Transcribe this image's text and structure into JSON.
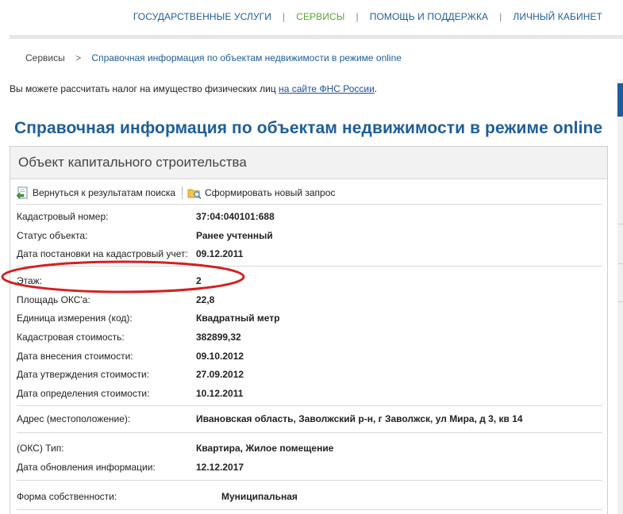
{
  "topnav": {
    "items": [
      {
        "label": "ГОСУДАРСТВЕННЫЕ УСЛУГИ",
        "active": false
      },
      {
        "label": "СЕРВИСЫ",
        "active": true
      },
      {
        "label": "ПОМОЩЬ И ПОДДЕРЖКА",
        "active": false
      },
      {
        "label": "ЛИЧНЫЙ КАБИНЕТ",
        "active": false
      }
    ],
    "separator": "|"
  },
  "breadcrumb": {
    "root": "Сервисы",
    "separator": ">",
    "current": "Справочная информация по объектам недвижимости в режиме online"
  },
  "notice": {
    "text": "Вы можете рассчитать налог на имущество физических лиц ",
    "link": "на сайте ФНС России",
    "suffix": "."
  },
  "page_title": "Справочная информация по объектам недвижимости в режиме online",
  "panel": {
    "title": "Объект капитального строительства",
    "toolbar": {
      "back_label": "Вернуться к результатам поиска",
      "new_request_label": "Сформировать новый запрос"
    },
    "rows": [
      {
        "label": "Кадастровый номер:",
        "value": "37:04:040101:688"
      },
      {
        "label": "Статус объекта:",
        "value": "Ранее учтенный"
      },
      {
        "label": "Дата постановки на кадастровый учет:",
        "value": "09.12.2011"
      },
      {
        "label": "Этаж:",
        "value": "2"
      },
      {
        "label": "Площадь ОКС'a:",
        "value": "22,8"
      },
      {
        "label": "Единица измерения (код):",
        "value": "Квадратный метр"
      },
      {
        "label": "Кадастровая стоимость:",
        "value": "382899,32"
      },
      {
        "label": "Дата внесения стоимости:",
        "value": "09.10.2012"
      },
      {
        "label": "Дата утверждения стоимости:",
        "value": "27.09.2012"
      },
      {
        "label": "Дата определения стоимости:",
        "value": "10.12.2011"
      },
      {
        "label": "Адрес (местоположение):",
        "value": "Ивановская область, Заволжский р-н, г Заволжск, ул Мира, д 3, кв 14"
      },
      {
        "label": "(ОКС) Тип:",
        "value": "Квартира, Жилое помещение"
      },
      {
        "label": "Дата обновления информации:",
        "value": "12.12.2017"
      },
      {
        "label": "Форма собственности:",
        "value": "Муниципальная"
      }
    ]
  },
  "colors": {
    "brand_blue": "#1f5e9a",
    "active_green": "#5aa333",
    "highlight_red": "#d42020"
  },
  "icons": {
    "back": "document-back-arrow-icon",
    "new_request": "folder-search-icon"
  }
}
